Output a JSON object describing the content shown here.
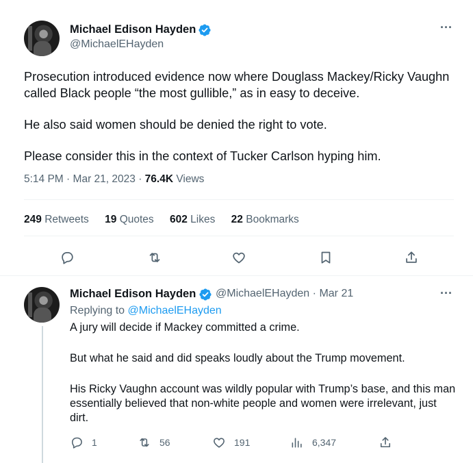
{
  "tweet": {
    "author_name": "Michael Edison Hayden",
    "author_handle": "@MichaelEHayden",
    "paragraphs": [
      "Prosecution introduced evidence now where Douglass Mackey/Ricky Vaughn called Black people “the most gullible,” as in easy to deceive.",
      "He also said women should be denied the right to vote.",
      "Please consider this in the context of Tucker Carlson hyping him."
    ],
    "time": "5:14 PM",
    "date": "Mar 21, 2023",
    "separator": "·",
    "views_count": "76.4K",
    "views_label": "Views",
    "stats": {
      "retweets_count": "249",
      "retweets_label": "Retweets",
      "quotes_count": "19",
      "quotes_label": "Quotes",
      "likes_count": "602",
      "likes_label": "Likes",
      "bookmarks_count": "22",
      "bookmarks_label": "Bookmarks"
    },
    "more_glyph": "···"
  },
  "reply": {
    "author_name": "Michael Edison Hayden",
    "author_handle": "@MichaelEHayden",
    "separator": "·",
    "date": "Mar 21",
    "replying_label": "Replying to",
    "replying_handle": "@MichaelEHayden",
    "paragraphs": [
      "A jury will decide if Mackey committed a crime.",
      "But what he said and did speaks loudly about the Trump movement.",
      "His Ricky Vaughn account was wildly popular with Trump’s base, and this man essentially believed that non-white people and women were irrelevant, just dirt."
    ],
    "replies_count": "1",
    "retweets_count": "56",
    "likes_count": "191",
    "views_count": "6,347",
    "more_glyph": "···"
  },
  "colors": {
    "accent": "#1d9bf0",
    "text": "#0f1419",
    "muted": "#536471",
    "divider": "#eff3f4"
  },
  "icons": [
    "verified-badge-icon",
    "more-icon",
    "reply-icon",
    "retweet-icon",
    "like-icon",
    "bookmark-icon",
    "share-icon",
    "views-icon"
  ]
}
